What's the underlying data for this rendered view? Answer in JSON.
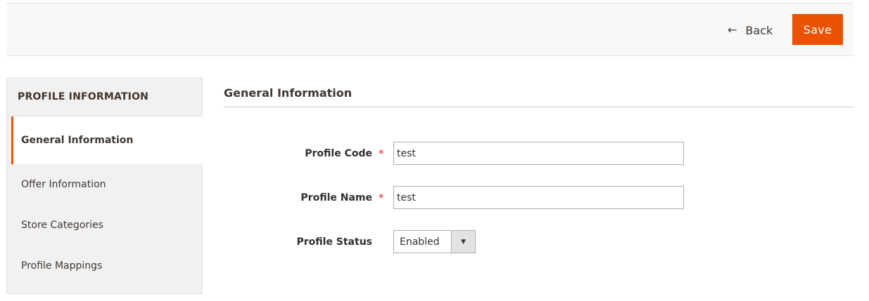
{
  "actions": {
    "back_label": "Back",
    "save_label": "Save"
  },
  "sidebar": {
    "title": "PROFILE INFORMATION",
    "items": [
      {
        "label": "General Information",
        "active": true
      },
      {
        "label": "Offer Information",
        "active": false
      },
      {
        "label": "Store Categories",
        "active": false
      },
      {
        "label": "Profile Mappings",
        "active": false
      }
    ]
  },
  "main": {
    "section_title": "General Information",
    "fields": {
      "profile_code": {
        "label": "Profile Code",
        "required": "*",
        "value": "test"
      },
      "profile_name": {
        "label": "Profile Name",
        "required": "*",
        "value": "test"
      },
      "profile_status": {
        "label": "Profile Status",
        "value": "Enabled"
      }
    }
  },
  "colors": {
    "accent": "#eb5202",
    "required": "#e22626"
  },
  "icons": {
    "back": "arrow-left-icon",
    "select": "triangle-down-icon"
  }
}
